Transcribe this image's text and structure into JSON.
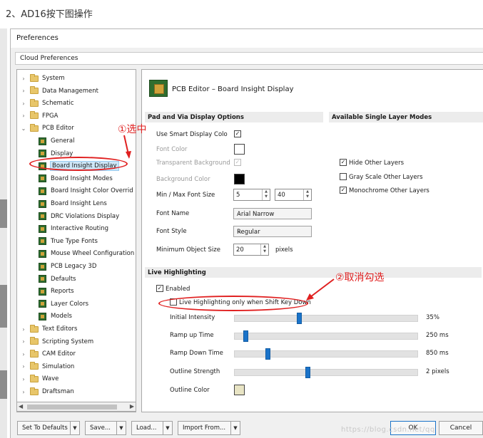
{
  "caption": "2、AD16按下图操作",
  "window": {
    "title": "Preferences",
    "cloud_prefs": "Cloud Preferences"
  },
  "tree": {
    "items": [
      {
        "label": "System",
        "type": "folder",
        "level": 0,
        "expanded": false
      },
      {
        "label": "Data Management",
        "type": "folder",
        "level": 0,
        "expanded": false
      },
      {
        "label": "Schematic",
        "type": "folder",
        "level": 0,
        "expanded": false
      },
      {
        "label": "FPGA",
        "type": "folder",
        "level": 0,
        "expanded": false
      },
      {
        "label": "PCB Editor",
        "type": "folder",
        "level": 0,
        "expanded": true
      },
      {
        "label": "General",
        "type": "page",
        "level": 1
      },
      {
        "label": "Display",
        "type": "page",
        "level": 1
      },
      {
        "label": "Board Insight Display",
        "type": "page",
        "level": 1,
        "selected": true
      },
      {
        "label": "Board Insight Modes",
        "type": "page",
        "level": 1
      },
      {
        "label": "Board Insight Color Overrid",
        "type": "page",
        "level": 1
      },
      {
        "label": "Board Insight Lens",
        "type": "page",
        "level": 1
      },
      {
        "label": "DRC Violations Display",
        "type": "page",
        "level": 1
      },
      {
        "label": "Interactive Routing",
        "type": "page",
        "level": 1
      },
      {
        "label": "True Type Fonts",
        "type": "page",
        "level": 1
      },
      {
        "label": "Mouse Wheel Configuration",
        "type": "page",
        "level": 1
      },
      {
        "label": "PCB Legacy 3D",
        "type": "page",
        "level": 1
      },
      {
        "label": "Defaults",
        "type": "page",
        "level": 1
      },
      {
        "label": "Reports",
        "type": "page",
        "level": 1
      },
      {
        "label": "Layer Colors",
        "type": "page",
        "level": 1
      },
      {
        "label": "Models",
        "type": "page",
        "level": 1
      },
      {
        "label": "Text Editors",
        "type": "folder",
        "level": 0,
        "expanded": false
      },
      {
        "label": "Scripting System",
        "type": "folder",
        "level": 0,
        "expanded": false
      },
      {
        "label": "CAM Editor",
        "type": "folder",
        "level": 0,
        "expanded": false
      },
      {
        "label": "Simulation",
        "type": "folder",
        "level": 0,
        "expanded": false
      },
      {
        "label": "Wave",
        "type": "folder",
        "level": 0,
        "expanded": false
      },
      {
        "label": "Draftsman",
        "type": "folder",
        "level": 0,
        "expanded": false
      }
    ]
  },
  "panel": {
    "title": "PCB Editor – Board Insight Display",
    "pad_via": {
      "header": "Pad and Via Display Options",
      "smart_display": "Use Smart Display Colo",
      "font_color": "Font Color",
      "transparent_bg": "Transparent Background",
      "bg_color": "Background Color",
      "min_max_font": "Min / Max Font Size",
      "min_font": "5",
      "max_font": "40",
      "font_name": "Font Name",
      "font_name_value": "Arial Narrow",
      "font_style": "Font Style",
      "font_style_value": "Regular",
      "min_obj": "Minimum Object Size",
      "min_obj_value": "20",
      "pixels": "pixels"
    },
    "single_layer": {
      "header": "Available Single Layer Modes",
      "hide_other": "Hide Other Layers",
      "gray_scale": "Gray Scale Other Layers",
      "monochrome": "Monochrome Other Layers"
    },
    "live": {
      "header": "Live Highlighting",
      "enabled": "Enabled",
      "shift_only": "Live Highlighting only when Shift Key Down",
      "initial_intensity": "Initial Intensity",
      "initial_intensity_value": "35%",
      "ramp_up": "Ramp up Time",
      "ramp_up_value": "250 ms",
      "ramp_down": "Ramp Down Time",
      "ramp_down_value": "850 ms",
      "outline_strength": "Outline Strength",
      "outline_strength_value": "2 pixels",
      "outline_color": "Outline Color"
    },
    "slider_levels": {
      "initial_intensity": 0.35,
      "ramp_up": 0.06,
      "ramp_down": 0.18,
      "outline_strength": 0.4
    }
  },
  "annotations": {
    "select": "①选中",
    "uncheck": "②取消勾选"
  },
  "footer": {
    "set_defaults": "Set To Defaults",
    "save": "Save...",
    "load": "Load...",
    "import": "Import From...",
    "ok": "OK",
    "cancel": "Cancel"
  },
  "watermark": "https://blog.csdn.net/qq",
  "colors": {
    "accent": "#1a73c9",
    "annotation": "#e02020",
    "outline_color": "#e8e4c4"
  }
}
